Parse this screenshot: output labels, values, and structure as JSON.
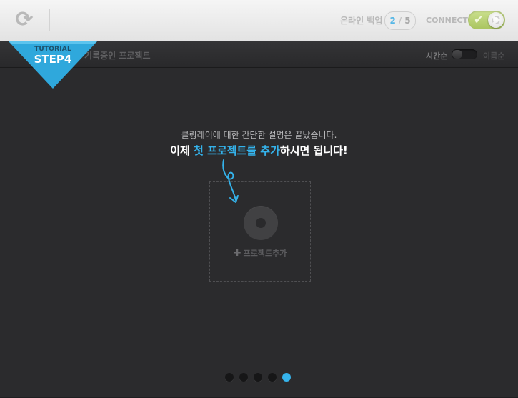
{
  "topbar": {
    "refresh_icon": "refresh-icon",
    "backup_label": "온라인 백업",
    "backup_used": "2",
    "backup_total": "5",
    "connect_label": "CONNECT",
    "connect_state": "on",
    "connect_color": "#b8d174"
  },
  "subbar": {
    "title": "기록중인 프로젝트",
    "sort_time": "시간순",
    "sort_name": "이름순"
  },
  "tutorial": {
    "small_label": "TUTORIAL",
    "step_label": "STEP4",
    "accent_color": "#2fa8dc"
  },
  "message": {
    "line1": "클링레이에 대한 간단한 설명은 끝났습니다.",
    "line2_prefix": "이제 ",
    "line2_accent": "첫 프로젝트를 추가",
    "line2_suffix": "하시면 됩니다!"
  },
  "add_project": {
    "icon": "disc-icon",
    "label": "프로젝트추가"
  },
  "pagination": {
    "total": 5,
    "active": 5
  }
}
